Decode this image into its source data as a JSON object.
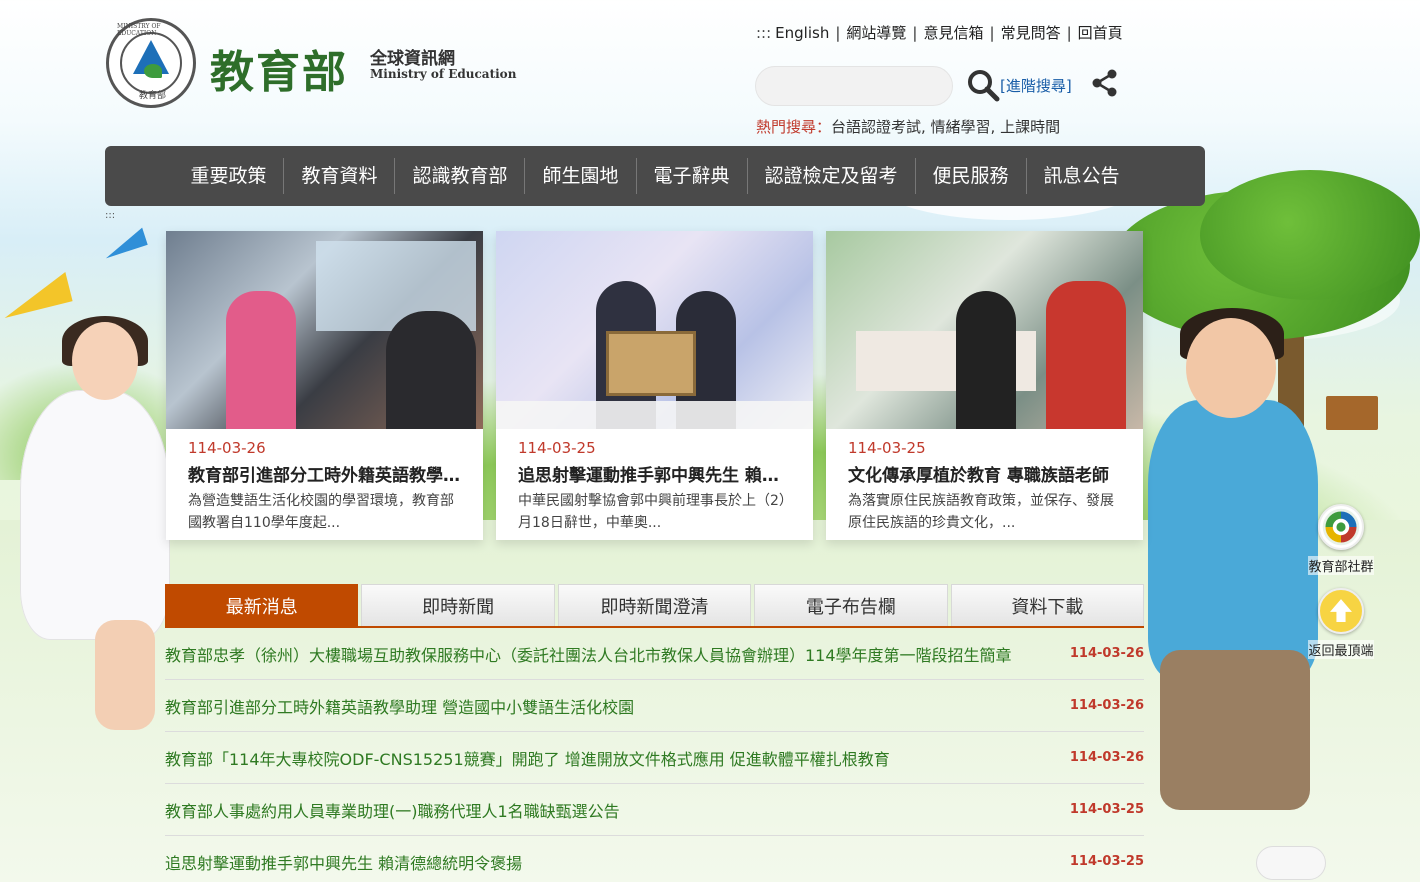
{
  "header": {
    "logo_cn": "教育部",
    "logo_sub_cn": "全球資訊網",
    "logo_sub_en": "Ministry of Education",
    "seal_top": "MINISTRY OF EDUCATION",
    "seal_bottom": "教育部"
  },
  "toplinks": {
    "lead": ":::",
    "items": [
      "English",
      "網站導覽",
      "意見信箱",
      "常見問答",
      "回首頁"
    ]
  },
  "search": {
    "placeholder": "",
    "advanced_label": "[進階搜尋]"
  },
  "hot_search": {
    "label": "熱門搜尋：",
    "terms": "台語認證考試, 情緒學習, 上課時間"
  },
  "nav": {
    "items": [
      "重要政策",
      "教育資料",
      "認識教育部",
      "師生園地",
      "電子辭典",
      "認證檢定及留考",
      "便民服務",
      "訊息公告"
    ]
  },
  "accesskey": ":::",
  "cards": [
    {
      "date": "114-03-26",
      "title": "教育部引進部分工時外籍英語教學助理",
      "desc": "為營造雙語生活化校園的學習環境，教育部國教署自110學年度起..."
    },
    {
      "date": "114-03-25",
      "title": "追思射擊運動推手郭中興先生 賴清德總統",
      "desc": "中華民國射擊協會郭中興前理事長於上（2）月18日辭世，中華奧..."
    },
    {
      "date": "114-03-25",
      "title": "文化傳承厚植於教育 專職族語老師",
      "desc": "為落實原住民族語教育政策，並保存、發展原住民族語的珍貴文化，..."
    }
  ],
  "tabs": {
    "items": [
      "最新消息",
      "即時新聞",
      "即時新聞澄清",
      "電子布告欄",
      "資料下載"
    ],
    "active": 0
  },
  "news": [
    {
      "title": "教育部忠孝（徐州）大樓職場互助教保服務中心（委託社團法人台北市教保人員協會辦理）114學年度第一階段招生簡章",
      "date": "114-03-26"
    },
    {
      "title": "教育部引進部分工時外籍英語教學助理 營造國中小雙語生活化校園",
      "date": "114-03-26"
    },
    {
      "title": "教育部「114年大專校院ODF-CNS15251競賽」開跑了 增進開放文件格式應用 促進軟體平權扎根教育",
      "date": "114-03-26"
    },
    {
      "title": "教育部人事處約用人員專業助理(一)職務代理人1名職缺甄選公告",
      "date": "114-03-25"
    },
    {
      "title": "追思射擊運動推手郭中興先生 賴清德總統明令褒揚",
      "date": "114-03-25"
    }
  ],
  "side": {
    "social_label": "教育部社群",
    "top_label": "返回最頂端"
  },
  "colors": {
    "accent": "#c04a00",
    "nav_bg": "#4a4a4a",
    "news_green": "#2f7a22",
    "date_red": "#c0392b",
    "logo_green": "#2e6e2a"
  }
}
